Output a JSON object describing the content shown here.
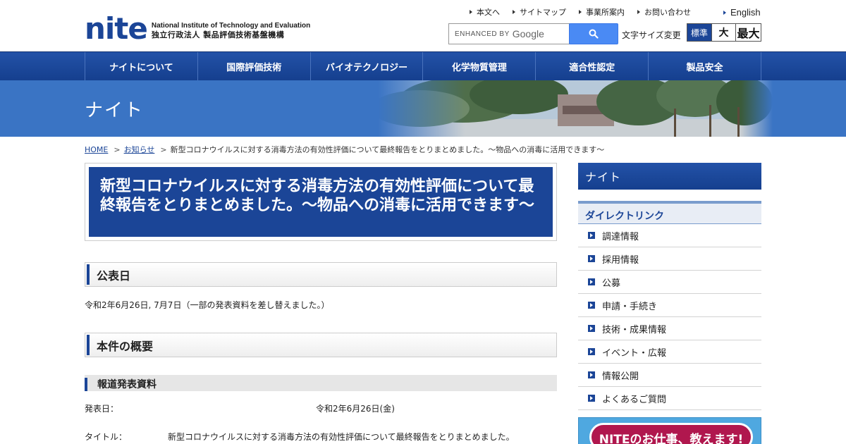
{
  "header": {
    "logo_mark": "nite",
    "logo_en": "National Institute of Technology and Evaluation",
    "logo_jp": "独立行政法人 製品評価技術基盤機構",
    "util_links": [
      "本文へ",
      "サイトマップ",
      "事業所案内",
      "お問い合わせ"
    ],
    "english_label": "English",
    "search_brand_prefix": "ENHANCED BY",
    "search_brand": "Google",
    "font_size_label": "文字サイズ変更",
    "font_size_options": [
      "標準",
      "大",
      "最大"
    ],
    "accent_color": "#1b4597"
  },
  "gnav": [
    "ナイトについて",
    "国際評価技術",
    "バイオテクノロジー",
    "化学物質管理",
    "適合性認定",
    "製品安全"
  ],
  "hero": {
    "title": "ナイト"
  },
  "breadcrumb": {
    "home": "HOME",
    "news": "お知らせ",
    "current": "新型コロナウイルスに対する消毒方法の有効性評価について最終報告をとりまとめました。～物品への消毒に活用できます～"
  },
  "main": {
    "title": "新型コロナウイルスに対する消毒方法の有効性評価について最終報告をとりまとめました。～物品への消毒に活用できます～",
    "sec1_heading": "公表日",
    "sec1_text": "令和2年6月26日, 7月7日（一部の発表資料を差し替えました。）",
    "sec2_heading": "本件の概要",
    "sub_heading": "報道発表資料",
    "release_date_label": "発表日：",
    "release_date_value": "令和2年6月26日(金)",
    "title_label": "タイトル：",
    "title_value": "新型コロナウイルスに対する消毒方法の有効性評価について最終報告をとりまとめました。"
  },
  "sidebar": {
    "head": "ナイト",
    "direct_link_heading": "ダイレクトリンク",
    "items": [
      "調達情報",
      "採用情報",
      "公募",
      "申請・手続き",
      "技術・成果情報",
      "イベント・広報",
      "情報公開",
      "よくあるご質問"
    ],
    "banner_text": "NITEのお仕事、教えます!"
  }
}
